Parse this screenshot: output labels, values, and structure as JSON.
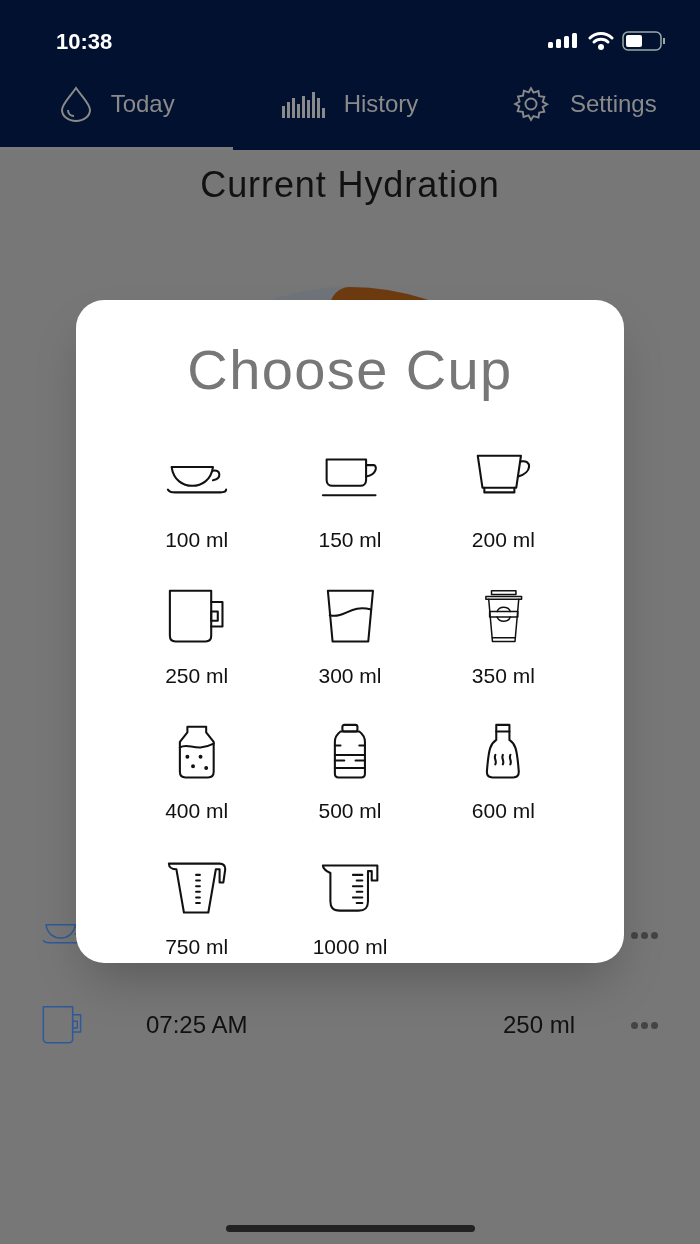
{
  "status_bar": {
    "time": "10:38"
  },
  "tabs": [
    {
      "label": "Today",
      "kind": "drop",
      "selected": true
    },
    {
      "label": "History",
      "kind": "bars",
      "selected": false
    },
    {
      "label": "Settings",
      "kind": "gear",
      "selected": false
    }
  ],
  "title": "Current Hydration",
  "log": [
    {
      "kind": "saucer"
    },
    {
      "kind": "mug",
      "time": "07:25 AM",
      "amount": "250 ml"
    }
  ],
  "dialog": {
    "title": "Choose Cup",
    "cups": [
      {
        "kind": "saucer",
        "label": "100 ml"
      },
      {
        "kind": "espresso",
        "label": "150 ml"
      },
      {
        "kind": "cup",
        "label": "200 ml"
      },
      {
        "kind": "mug",
        "label": "250 ml"
      },
      {
        "kind": "glass",
        "label": "300 ml"
      },
      {
        "kind": "takeaway",
        "label": "350 ml"
      },
      {
        "kind": "jar",
        "label": "400 ml"
      },
      {
        "kind": "bottle",
        "label": "500 ml"
      },
      {
        "kind": "flask",
        "label": "600 ml"
      },
      {
        "kind": "jug",
        "label": "750 ml"
      },
      {
        "kind": "beaker",
        "label": "1000 ml"
      }
    ]
  }
}
